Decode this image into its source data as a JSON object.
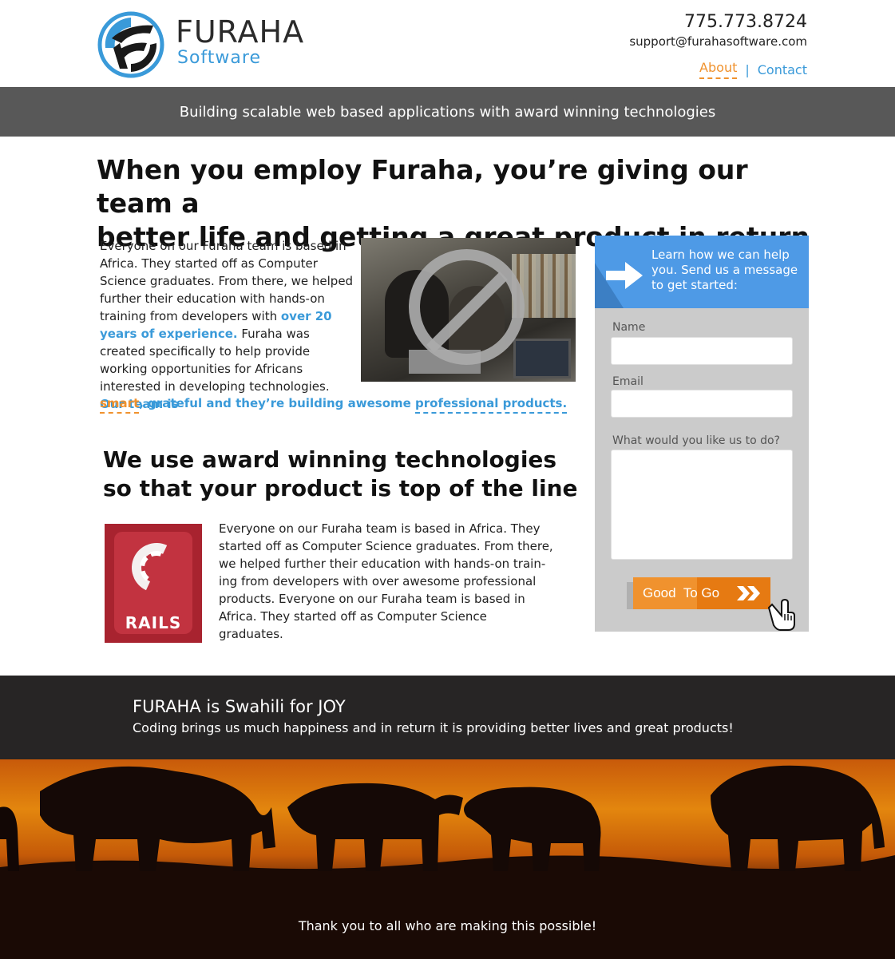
{
  "brand": {
    "name": "FURAHA",
    "sub": "Software",
    "colors": {
      "blue": "#3a9ad9",
      "orange": "#f0922e",
      "dark": "#272525"
    }
  },
  "contact": {
    "phone": "775.773.8724",
    "email": "support@furahasoftware.com"
  },
  "nav": {
    "about": "About",
    "separator": "|",
    "contact": "Contact"
  },
  "tagline": "Building scalable web based applications with award winning technologies",
  "hero": {
    "heading_line1": "When you employ Furaha, you’re giving our team a",
    "heading_line2": "better life and getting a great product in return"
  },
  "intro": {
    "text_a": "Everyone on our Furaha team is based in Africa. They started off as Computer Science graduates. From there, we helped further their education with hands-on training from developers with ",
    "highlight_a": "over 20 years of experience.",
    "text_b": " Furaha was created specifically to help provide working opportunities for Africans interested in developing technologies. ",
    "highlight_b": "Our team is",
    "smart": "smart",
    "comma": ",",
    "highlight_c": " grateful and they’re building awesome ",
    "professional": "professional products."
  },
  "form": {
    "intro": "Learn how we can help you. Send us a message to get started:",
    "name_label": "Name",
    "email_label": "Email",
    "message_label": "What would you like us to do?",
    "submit": "Good  To Go"
  },
  "tech": {
    "heading_line1": "We use award winning technologies",
    "heading_line2": "so that your product is top of the line",
    "logo_word": "RAILS",
    "text": "Everyone on our Furaha team is based in Africa. They started off as Computer Science graduates. From there, we helped further their education with hands-on train- ing from developers with over awesome professional products. Everyone on our Furaha team is based in Africa. They started off as Computer Science graduates."
  },
  "joy": {
    "title": "FURAHA is Swahili for JOY",
    "subtitle": "Coding brings us much happiness and in return it is providing better lives and great products!"
  },
  "footer": {
    "thanks": "Thank you to all who are making this possible!"
  }
}
